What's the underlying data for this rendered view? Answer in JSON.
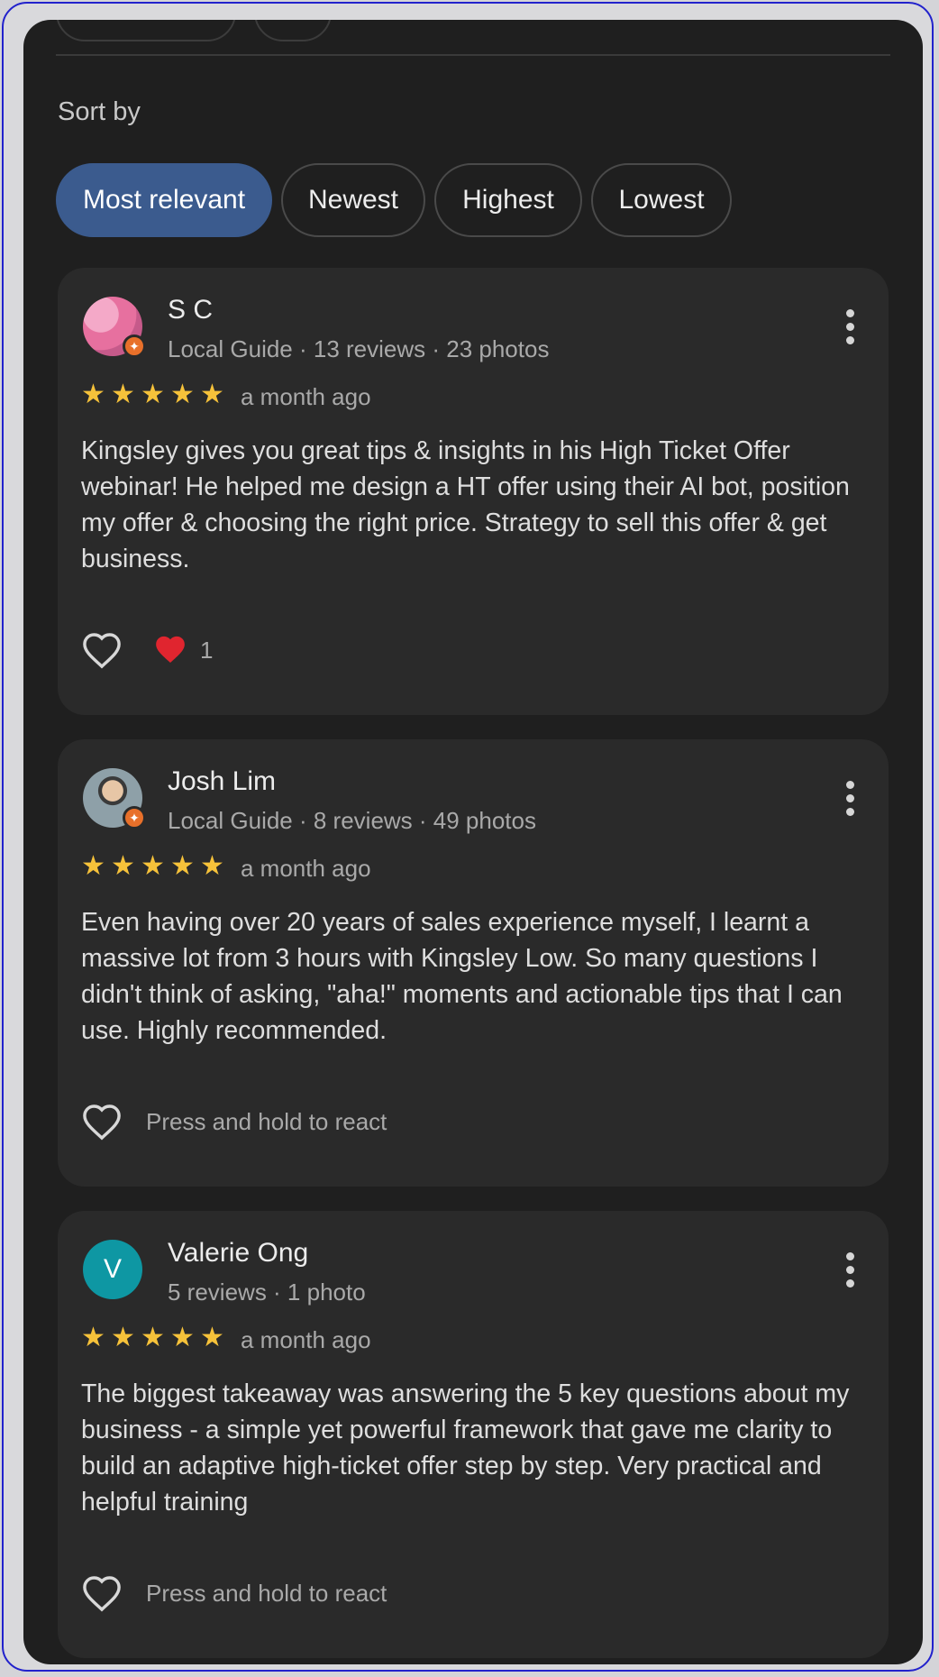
{
  "sort": {
    "label": "Sort by",
    "options": [
      "Most relevant",
      "Newest",
      "Highest",
      "Lowest"
    ],
    "selected": "Most relevant"
  },
  "colors": {
    "accent": "#3b5b8e",
    "star": "#f6c23a",
    "badge": "#e8702a"
  },
  "reviews": [
    {
      "name": "S C",
      "meta": "Local Guide · 13 reviews · 23 photos",
      "rating": 5,
      "date": "a month ago",
      "text": "Kingsley gives you great tips & insights in his High Ticket Offer webinar! He helped me design a HT offer using their AI bot, position my offer & choosing the right price. Strategy to sell this offer & get business.",
      "reaction_count": "1",
      "reaction_icon": "red-heart-icon"
    },
    {
      "name": "Josh Lim",
      "meta": "Local Guide · 8 reviews · 49 photos",
      "rating": 5,
      "date": "a month ago",
      "text": "Even having over 20 years of sales experience myself, I learnt a massive lot from 3 hours with Kingsley Low. So many questions I didn't think of asking, \"aha!\" moments and actionable tips that I can use. Highly recommended.",
      "react_hint": "Press and hold to react"
    },
    {
      "name": "Valerie Ong",
      "avatar_letter": "V",
      "meta": "5 reviews · 1 photo",
      "rating": 5,
      "date": "a month ago",
      "text": "The biggest takeaway was answering the 5 key questions about my business - a simple yet powerful framework that gave me clarity to build an adaptive high-ticket offer step by step. Very practical and helpful training",
      "react_hint": "Press and hold to react"
    }
  ]
}
